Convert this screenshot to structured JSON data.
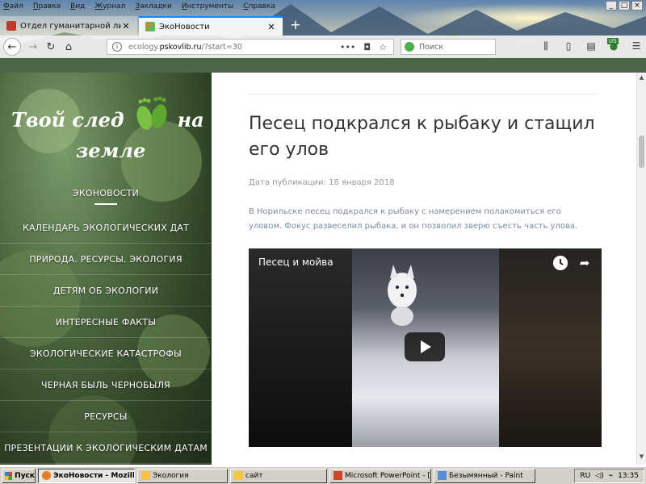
{
  "menubar": [
    "Файл",
    "Правка",
    "Вид",
    "Журнал",
    "Закладки",
    "Инструменты",
    "Справка"
  ],
  "tabs": [
    {
      "title": "Отдел гуманитарной литератур",
      "active": false,
      "favicon_color": "#c0392b"
    },
    {
      "title": "ЭкоНовости",
      "active": true,
      "favicon_color": "#e67e22"
    }
  ],
  "url": {
    "prefix": "ecology.",
    "domain": "pskovlib.ru",
    "path": "/?start=30"
  },
  "search_placeholder": "Поиск",
  "toolbar_badge": "US",
  "site": {
    "logo_line1_a": "Твой след",
    "logo_line1_b": "на",
    "logo_line2": "земле",
    "menu": [
      {
        "label": "ЭКОНОВОСТИ",
        "active": true
      },
      {
        "label": "КАЛЕНДАРЬ ЭКОЛОГИЧЕСКИХ ДАТ"
      },
      {
        "label": "ПРИРОДА. РЕСУРСЫ. ЭКОЛОГИЯ"
      },
      {
        "label": "ДЕТЯМ ОБ ЭКОЛОГИИ"
      },
      {
        "label": "ИНТЕРЕСНЫЕ ФАКТЫ"
      },
      {
        "label": "ЭКОЛОГИЧЕСКИЕ КАТАСТРОФЫ"
      },
      {
        "label": "ЧЕРНАЯ БЫЛЬ ЧЕРНОБЫЛЯ"
      },
      {
        "label": "РЕСУРСЫ"
      },
      {
        "label": "ПРЕЗЕНТАЦИИ К ЭКОЛОГИЧЕСКИМ ДАТАМ"
      }
    ]
  },
  "article": {
    "title": "Песец подкрался к рыбаку и стащил его улов",
    "pubdate": "Дата публикации: 18 января 2018",
    "lead": "В Норильске песец подкрался к рыбаку с намерением полакомиться его уловом. Фокус развеселил рыбака, и он позволил зверю съесть часть улова.",
    "video_title": "Песец и мойва"
  },
  "taskbar": {
    "start": "Пуск",
    "tasks": [
      {
        "label": "ЭкоНовости - Mozilla ...",
        "active": true,
        "icon_color": "#e67e22"
      },
      {
        "label": "Экология",
        "active": false,
        "icon_color": "#f4c542"
      },
      {
        "label": "сайт",
        "active": false,
        "icon_color": "#f4c542"
      },
      {
        "label": "Microsoft PowerPoint - [с...",
        "active": false,
        "icon_color": "#d24726"
      },
      {
        "label": "Безымянный - Paint",
        "active": false,
        "icon_color": "#5b8dd6"
      }
    ],
    "lang": "RU",
    "time": "13:35"
  }
}
